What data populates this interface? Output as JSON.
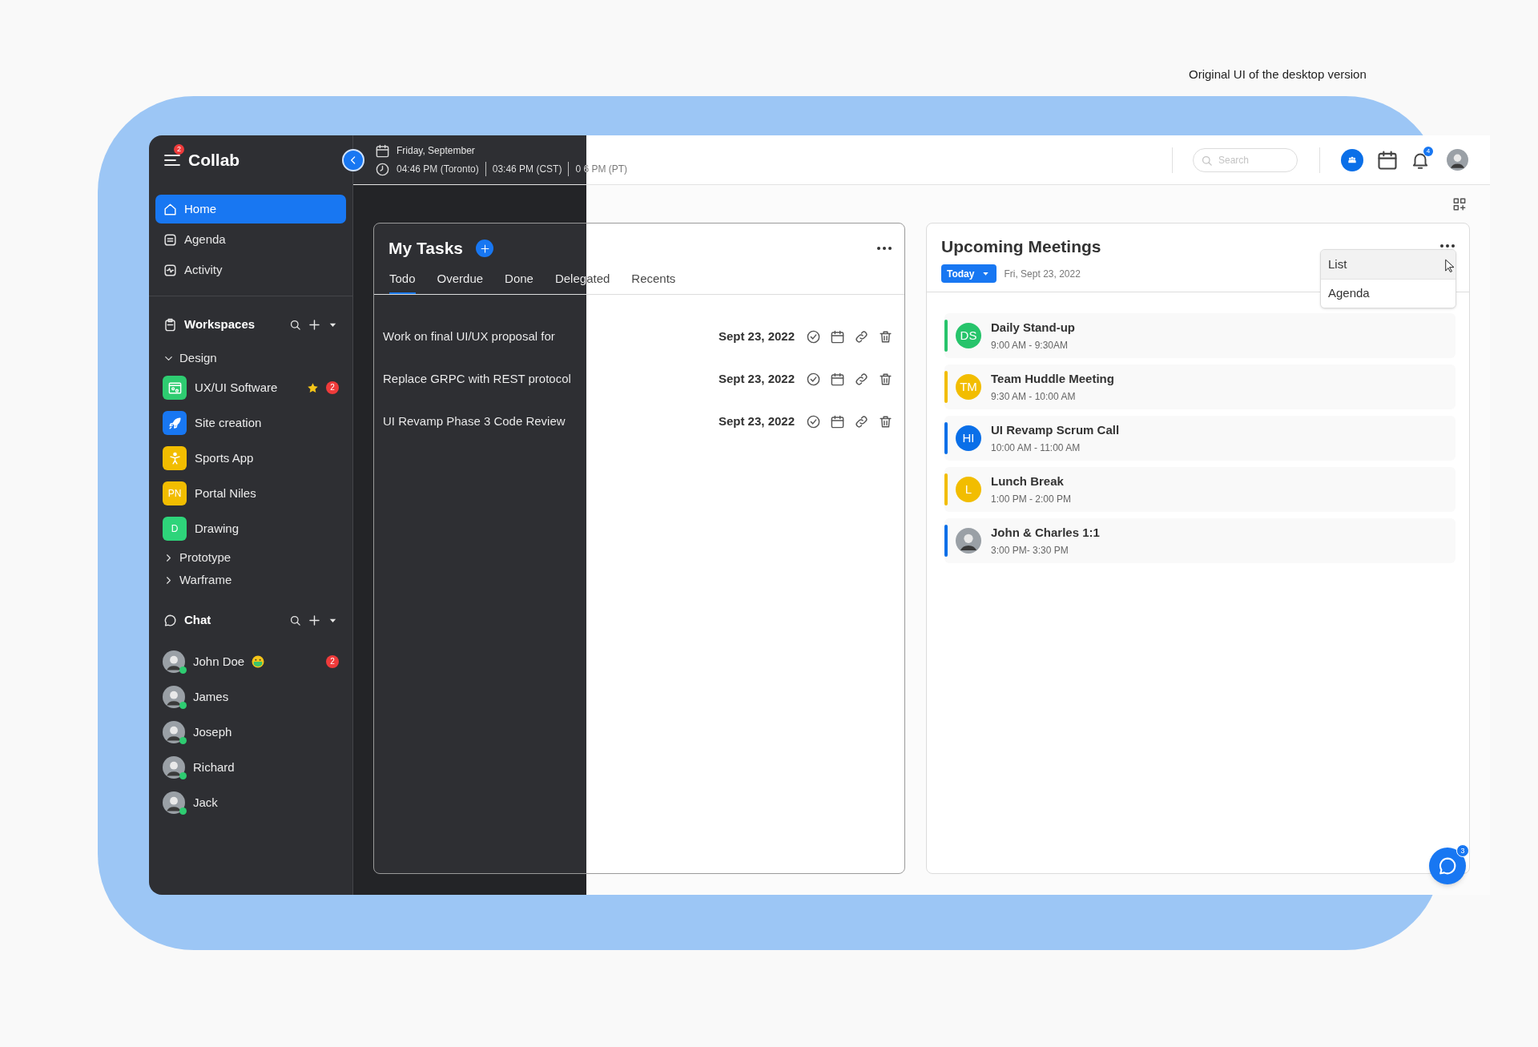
{
  "caption": "Original UI of the desktop version",
  "sidebar": {
    "menu_badge": "2",
    "app_name": "Collab",
    "nav": [
      {
        "label": "Home",
        "kind": "home",
        "selected": true
      },
      {
        "label": "Agenda",
        "kind": "agenda",
        "selected": false
      },
      {
        "label": "Activity",
        "kind": "activity",
        "selected": false
      }
    ],
    "workspaces": {
      "title": "Workspaces",
      "groups": [
        {
          "label": "Design",
          "expanded": true,
          "children": [
            {
              "label": "UX/UI Software",
              "kind": "window",
              "color": "#2ecc71",
              "starred": true,
              "badge": "2"
            },
            {
              "label": "Site creation",
              "kind": "rocket",
              "color": "#1877f2",
              "starred": false
            },
            {
              "label": "Sports App",
              "kind": "figure",
              "color": "#f2bd00",
              "starred": false
            },
            {
              "label": "Portal Niles",
              "kind": "initials",
              "initials": "PN",
              "color": "#f2bd00",
              "starred": false
            },
            {
              "label": "Drawing",
              "kind": "initials",
              "initials": "D",
              "color": "#2ed47a",
              "starred": false
            }
          ]
        },
        {
          "label": "Prototype",
          "expanded": false
        },
        {
          "label": "Warframe",
          "expanded": false
        }
      ]
    },
    "chat": {
      "title": "Chat",
      "contacts": [
        {
          "name": "John Doe",
          "online": true,
          "mask_emoji": true,
          "badge": "2"
        },
        {
          "name": "James",
          "online": true,
          "mask_emoji": false
        },
        {
          "name": "Joseph",
          "online": true,
          "mask_emoji": false
        },
        {
          "name": "Richard",
          "online": true,
          "mask_emoji": false
        },
        {
          "name": "Jack",
          "online": true,
          "mask_emoji": false
        }
      ]
    }
  },
  "topbar": {
    "date": "Friday, September",
    "times": [
      "04:46 PM (Toronto)",
      "03:46 PM (CST)",
      "0 6 PM (PT)"
    ],
    "search": {
      "placeholder": "Search"
    },
    "notifications_badge": "4"
  },
  "tasks": {
    "title": "My Tasks",
    "tabs": [
      {
        "label": "Todo",
        "selected": true
      },
      {
        "label": "Overdue",
        "selected": false
      },
      {
        "label": "Done",
        "selected": false
      },
      {
        "label": "Delegated",
        "selected": false
      },
      {
        "label": "Recents",
        "selected": false
      }
    ],
    "rows": [
      {
        "title": "Work on final UI/UX proposal for",
        "date": "Sept 23, 2022"
      },
      {
        "title": "Replace GRPC with REST protocol",
        "date": "Sept 23, 2022"
      },
      {
        "title": "UI Revamp Phase 3 Code Review",
        "date": "Sept 23, 2022"
      }
    ]
  },
  "meetings": {
    "title": "Upcoming Meetings",
    "filter": "Today",
    "date": "Fri, Sept 23, 2022",
    "menu": [
      {
        "label": "List",
        "selected": true
      },
      {
        "label": "Agenda",
        "selected": false
      }
    ],
    "items": [
      {
        "title": "Daily Stand-up",
        "time": "9:00 AM - 9:30AM",
        "kind": "initials",
        "initials": "DS",
        "color": "#27c46b"
      },
      {
        "title": "Team Huddle Meeting",
        "time": "9:30 AM - 10:00 AM",
        "kind": "initials",
        "initials": "TM",
        "color": "#f2bd00"
      },
      {
        "title": "UI Revamp Scrum Call",
        "time": "10:00 AM - 11:00 AM",
        "kind": "initials",
        "initials": "HI",
        "color": "#0a6fe8"
      },
      {
        "title": "Lunch Break",
        "time": "1:00 PM - 2:00 PM",
        "kind": "initials",
        "initials": "L",
        "color": "#f2bd00"
      },
      {
        "title": "John & Charles 1:1",
        "time": "3:00 PM- 3:30 PM",
        "kind": "photo",
        "color": "#0a6fe8"
      }
    ]
  },
  "chat_button_badge": "3"
}
